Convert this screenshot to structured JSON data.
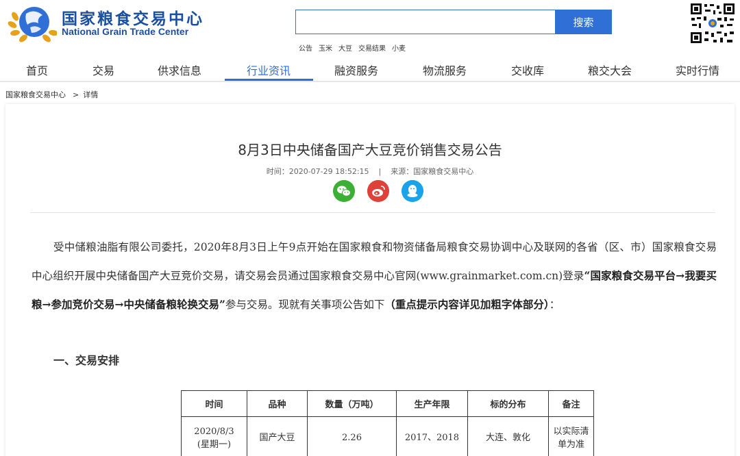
{
  "header": {
    "logo_cn": "国家粮食交易中心",
    "logo_en": "National Grain Trade Center",
    "search": {
      "placeholder": "",
      "button_label": "搜索"
    },
    "hot_words": [
      "公告",
      "玉米",
      "大豆",
      "交易结果",
      "小麦"
    ]
  },
  "nav": {
    "items": [
      "首页",
      "交易",
      "供求信息",
      "行业资讯",
      "融资服务",
      "物流服务",
      "交收库",
      "粮交大会",
      "实时行情"
    ],
    "active": "行业资讯"
  },
  "breadcrumb": {
    "home": "国家粮食交易中心",
    "separator": ">",
    "current": "详情"
  },
  "article": {
    "title": "8月3日中央储备国产大豆竞价销售交易公告",
    "time": "时间：2020-07-29 18:52:15",
    "meta_sep": "|",
    "source": "来源：国家粮食交易中心",
    "paragraph_start": "受中储粮油脂有限公司委托，2020年8月3日上午9点开始在国家粮食和物资储备局粮食交易协调中心及联网的各省（区、市）国家粮食交易中心组织开展中央储备国产大豆竞价交易，请交易会员通过国家粮食交易中心官网(www.grainmarket.com.cn)登录",
    "paragraph_bold": "“国家粮食交易平台→我要买粮→参加竞价交易→中央储备粮轮换交易”",
    "paragraph_mid": "参与交易。现就有关事项公告如下",
    "paragraph_note": "（重点提示内容详见加粗字体部分）",
    "paragraph_end": "：",
    "section1": "一、交易安排"
  },
  "table": {
    "headers": [
      "时间",
      "品种",
      "数量（万吨）",
      "生产年限",
      "标的分布",
      "备注"
    ],
    "row": {
      "date": "2020/8/3",
      "weekday": "(星期一)",
      "variety": "国产大豆",
      "quantity": "2.26",
      "years": "2017、2018",
      "location": "大连、敦化",
      "note_l1": "以实际清",
      "note_l2": "单为准"
    }
  },
  "colors": {
    "brand": "#1a4fa0",
    "accent": "#2f6fd6",
    "wechat": "#3cb034",
    "weibo": "#e0403a",
    "qq": "#1aa3e8"
  },
  "icons": [
    "logo-emblem-icon",
    "qr-code-icon",
    "wechat-icon",
    "weibo-icon",
    "qq-icon"
  ]
}
